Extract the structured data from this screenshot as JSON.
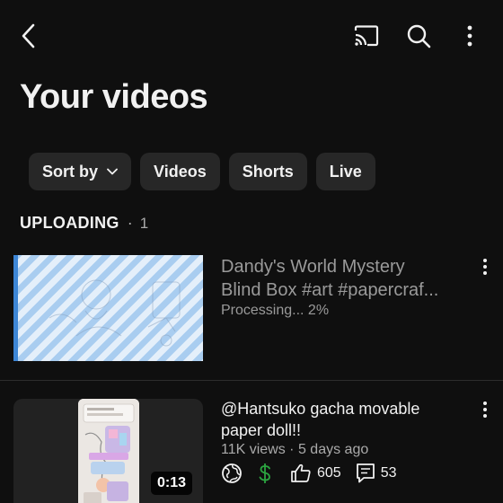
{
  "header": {
    "back_icon": "chevron-left-icon",
    "cast_icon": "cast-icon",
    "search_icon": "search-icon",
    "more_icon": "more-vertical-icon"
  },
  "page": {
    "title": "Your videos"
  },
  "filters": {
    "sort_label": "Sort by",
    "chips": [
      "Videos",
      "Shorts",
      "Live"
    ]
  },
  "uploading": {
    "label": "UPLOADING",
    "separator": "·",
    "count": "1",
    "item": {
      "title_line1": "Dandy's World Mystery",
      "title_line2": "Blind Box #art #papercraf...",
      "status": "Processing... 2%",
      "progress_percent": 2
    }
  },
  "videos": [
    {
      "title_line1": "@Hantsuko gacha movable",
      "title_line2": "paper doll!!",
      "meta": "11K views · 5 days ago",
      "duration": "0:13",
      "likes": "605",
      "comments": "53"
    }
  ],
  "colors": {
    "background": "#0f0f0f",
    "chip": "#272727",
    "monetization": "#2ba640",
    "processing_stripe": "#a9cdf0"
  }
}
